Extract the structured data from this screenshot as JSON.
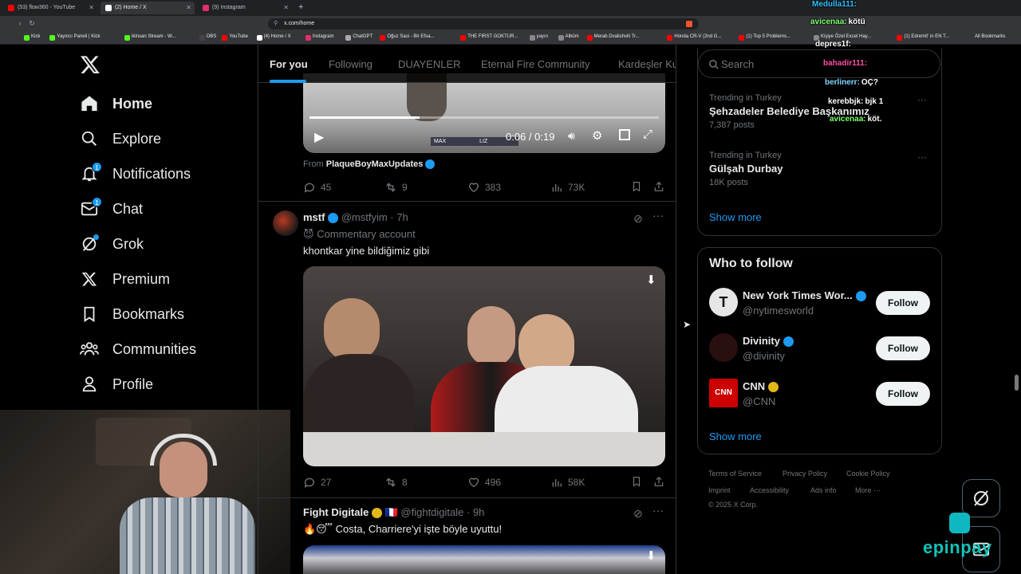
{
  "browser": {
    "tabs": [
      {
        "title": "(53) flow360 - YouTube",
        "color": "#ff0000"
      },
      {
        "title": "(2) Home / X",
        "color": "#ffffff"
      },
      {
        "title": "(9) Instagram",
        "color": "#e1306c"
      }
    ],
    "url": "x.com/home",
    "bookmarks": [
      {
        "label": "Kick",
        "color": "#53fc18"
      },
      {
        "label": "Yayıncı Paneli | Kick",
        "color": "#53fc18"
      },
      {
        "label": "ikinsan Stream - W...",
        "color": "#53fc18"
      },
      {
        "label": "OBS",
        "color": "#444444"
      },
      {
        "label": "YouTube",
        "color": "#ff0000"
      },
      {
        "label": "(4) Home / X",
        "color": "#ffffff"
      },
      {
        "label": "Instagram",
        "color": "#e1306c"
      },
      {
        "label": "ChatGPT",
        "color": "#aaaaaa"
      },
      {
        "label": "Oğuz Sasi - Bir Efsa...",
        "color": "#ff0000"
      },
      {
        "label": "THE FIRST GOKTUR...",
        "color": "#ff0000"
      },
      {
        "label": "yayın",
        "color": "#888888"
      },
      {
        "label": "Albüm",
        "color": "#888888"
      },
      {
        "label": "Merab Dvalishvili Tr...",
        "color": "#ff0000"
      },
      {
        "label": "Honda CR-V (2nd G...",
        "color": "#ff0000"
      },
      {
        "label": "(1) Top 5 Problems...",
        "color": "#ff0000"
      },
      {
        "label": "Kişiye Özel Excel Hay...",
        "color": "#888888"
      },
      {
        "label": "(1) Edremit' in EN T...",
        "color": "#ff0000"
      }
    ],
    "all_bookmarks": "All Bookmarks"
  },
  "nav": {
    "items": [
      {
        "label": "Home",
        "icon": "home-icon"
      },
      {
        "label": "Explore",
        "icon": "search-icon"
      },
      {
        "label": "Notifications",
        "icon": "bell-icon",
        "badge": "1"
      },
      {
        "label": "Chat",
        "icon": "mail-icon",
        "badge": "1"
      },
      {
        "label": "Grok",
        "icon": "grok-icon"
      },
      {
        "label": "Premium",
        "icon": "x-logo-icon"
      },
      {
        "label": "Bookmarks",
        "icon": "bookmark-icon"
      },
      {
        "label": "Communities",
        "icon": "people-icon"
      },
      {
        "label": "Profile",
        "icon": "person-icon"
      }
    ]
  },
  "feed": {
    "tabs": [
      "For you",
      "Following",
      "DUAYENLER",
      "Eternal Fire Community",
      "Kardeşler Ku"
    ],
    "post1": {
      "video_time": "0:06 / 0:19",
      "scoreboard_left": "MAX",
      "scoreboard_right": "LIZ",
      "from_label": "From",
      "from_account": "PlaqueBoyMaxUpdates",
      "replies": "45",
      "reposts": "9",
      "likes": "383",
      "views": "73K"
    },
    "post2": {
      "name": "mstf",
      "handle": "@mstfyim",
      "time": "· 7h",
      "label_emoji": "😈",
      "label": "Commentary account",
      "text": "khontkar yine bildiğimiz gibi",
      "replies": "27",
      "reposts": "8",
      "likes": "496",
      "views": "58K"
    },
    "post3": {
      "name": "Fight Digitale",
      "flag": "🇫🇷",
      "handle": "@fightdigitale",
      "time": "· 9h",
      "text": "🔥😴 Costa, Charriere'yi işte böyle uyuttu!"
    }
  },
  "right": {
    "search_placeholder": "Search",
    "trends": [
      {
        "context": "Trending in Turkey",
        "title": "Şehzadeler Belediye Başkanımız",
        "count": "7,387 posts"
      },
      {
        "context": "Trending in Turkey",
        "title": "Gülşah Durbay",
        "count": "18K posts"
      }
    ],
    "show_more": "Show more",
    "who_to_follow": "Who to follow",
    "follow_suggestions": [
      {
        "name": "New York Times Wor...",
        "handle": "@nytimesworld",
        "avatar_text": "T",
        "avatar_bg": "#e6e6e6",
        "verified": "blue"
      },
      {
        "name": "Divinity",
        "handle": "@divinity",
        "avatar_text": "",
        "avatar_bg": "#2a0f0f",
        "verified": "blue"
      },
      {
        "name": "CNN",
        "handle": "@CNN",
        "avatar_text": "CNN",
        "avatar_bg": "#cc0000",
        "verified": "gold"
      }
    ],
    "follow_label": "Follow",
    "footer": [
      "Terms of Service",
      "Privacy Policy",
      "Cookie Policy",
      "Imprint",
      "Accessibility",
      "Ads info",
      "More ···",
      "© 2025 X Corp."
    ]
  },
  "overlay_chat": [
    {
      "name": "Medulla111:",
      "msg": "",
      "color": "#2fbfff"
    },
    {
      "name": "avicenaa:",
      "msg": "kötü",
      "color": "#7cff6b"
    },
    {
      "name": "depres1f:",
      "msg": "",
      "color": "#ffffff"
    },
    {
      "name": "bahadir111:",
      "msg": "",
      "color": "#ff4fa3"
    },
    {
      "name": "berlinerr:",
      "msg": "OÇ?",
      "color": "#7fd7ff"
    },
    {
      "name": "kerebbjk:",
      "msg": "bjk 1",
      "color": "#ffffff"
    },
    {
      "name": "avicenaa:",
      "msg": "köt.",
      "color": "#7cff6b"
    }
  ],
  "overlay_logo": "epinpay"
}
